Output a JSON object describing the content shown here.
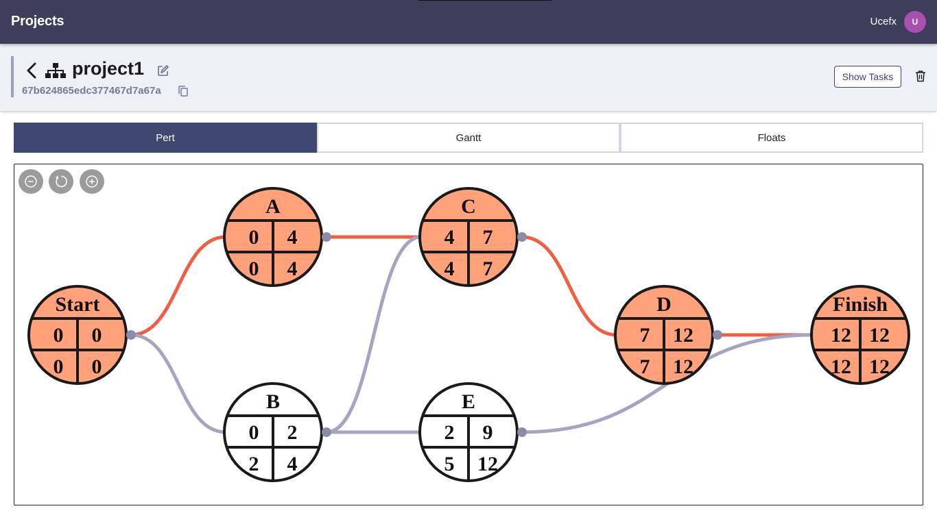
{
  "app": {
    "title": "Projects",
    "user_name": "Ucefx",
    "user_initial": "U"
  },
  "project": {
    "name": "project1",
    "id": "67b624865edc377467d7a67a"
  },
  "toolbar": {
    "show_tasks_label": "Show Tasks"
  },
  "tabs": [
    {
      "label": "Pert",
      "active": true
    },
    {
      "label": "Gantt",
      "active": false
    },
    {
      "label": "Floats",
      "active": false
    }
  ],
  "zoom_controls": [
    {
      "name": "zoom-out-icon"
    },
    {
      "name": "reset-zoom-icon"
    },
    {
      "name": "zoom-in-icon"
    }
  ],
  "colors": {
    "topbar": "#3f3d5a",
    "critical_node": "#ffa27c",
    "normal_node": "#ffffff",
    "critical_edge": "#ee5f45",
    "normal_edge": "#a6a5c0",
    "port": "#8c8ca8",
    "active_tab": "#3f4870",
    "avatar": "#a94fb0"
  },
  "pert": {
    "nodes": [
      {
        "id": "Start",
        "label": "Start",
        "es": "0",
        "ef": "0",
        "ls": "0",
        "lf": "0",
        "critical": true
      },
      {
        "id": "A",
        "label": "A",
        "es": "0",
        "ef": "4",
        "ls": "0",
        "lf": "4",
        "critical": true
      },
      {
        "id": "B",
        "label": "B",
        "es": "0",
        "ef": "2",
        "ls": "2",
        "lf": "4",
        "critical": false
      },
      {
        "id": "C",
        "label": "C",
        "es": "4",
        "ef": "7",
        "ls": "4",
        "lf": "7",
        "critical": true
      },
      {
        "id": "E",
        "label": "E",
        "es": "2",
        "ef": "9",
        "ls": "5",
        "lf": "12",
        "critical": false
      },
      {
        "id": "D",
        "label": "D",
        "es": "7",
        "ef": "12",
        "ls": "7",
        "lf": "12",
        "critical": true
      },
      {
        "id": "Finish",
        "label": "Finish",
        "es": "12",
        "ef": "12",
        "ls": "12",
        "lf": "12",
        "critical": true
      }
    ],
    "edges": [
      {
        "from": "Start",
        "to": "A",
        "critical": true
      },
      {
        "from": "Start",
        "to": "B",
        "critical": false
      },
      {
        "from": "A",
        "to": "C",
        "critical": true
      },
      {
        "from": "B",
        "to": "C",
        "critical": false
      },
      {
        "from": "B",
        "to": "E",
        "critical": false
      },
      {
        "from": "C",
        "to": "D",
        "critical": true
      },
      {
        "from": "D",
        "to": "Finish",
        "critical": true
      },
      {
        "from": "E",
        "to": "Finish",
        "critical": false
      }
    ]
  }
}
